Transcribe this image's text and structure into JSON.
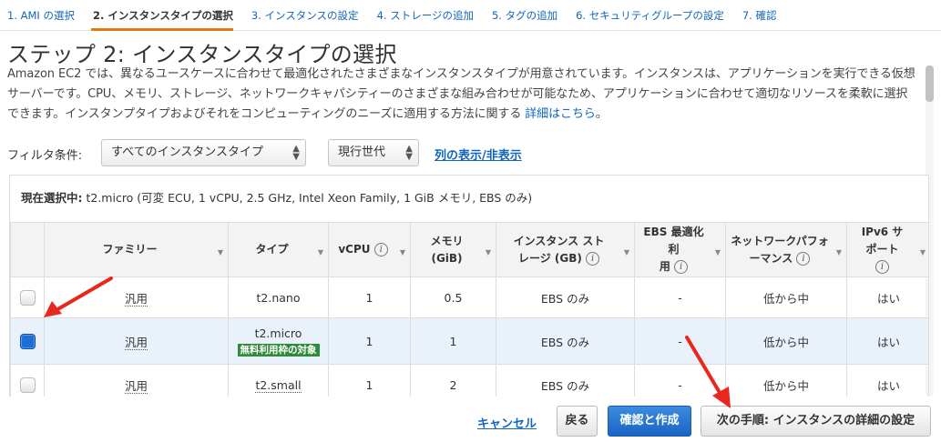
{
  "wizard": {
    "steps": [
      {
        "label": "1. AMI の選択"
      },
      {
        "label": "2. インスタンスタイプの選択"
      },
      {
        "label": "3. インスタンスの設定"
      },
      {
        "label": "4. ストレージの追加"
      },
      {
        "label": "5. タグの追加"
      },
      {
        "label": "6. セキュリティグループの設定"
      },
      {
        "label": "7. 確認"
      }
    ],
    "active_step": 1
  },
  "page": {
    "title": "ステップ 2: インスタンスタイプの選択",
    "description": "Amazon EC2 では、異なるユースケースに合わせて最適化されたさまざまなインスタンスタイプが用意されています。インスタンスは、アプリケーションを実行できる仮想サーバーです。CPU、メモリ、ストレージ、ネットワークキャパシティーのさまざまな組み合わせが可能なため、アプリケーションに合わせて適切なリソースを柔軟に選択できます。インスタンプタイプおよびそれをコンピューティングのニーズに適用する方法に関する",
    "details_link": "詳細はこちら",
    "period": "。"
  },
  "filter": {
    "label": "フィルタ条件:",
    "type_select": "すべてのインスタンスタイプ",
    "generation_select": "現行世代",
    "toggle_columns": "列の表示/非表示"
  },
  "selection": {
    "prefix": "現在選択中:",
    "value": " t2.micro (可変 ECU, 1 vCPU, 2.5 GHz, Intel Xeon Family, 1 GiB メモリ, EBS のみ)"
  },
  "table": {
    "headers": {
      "family": "ファミリー",
      "type": "タイプ",
      "vcpu": "vCPU",
      "memory_line1": "メモリ",
      "memory_line2": "(GiB)",
      "storage_line1": "インスタンス スト",
      "storage_line2": "レージ (GB)",
      "ebs_line1": "EBS 最適化利",
      "ebs_line2": "用",
      "network_line1": "ネットワークパフォ",
      "network_line2": "ーマンス",
      "ipv6_line1": "IPv6 サ",
      "ipv6_line2": "ポート"
    },
    "rows": [
      {
        "family": "汎用",
        "type": "t2.nano",
        "badge": "",
        "vcpu": "1",
        "memory": "0.5",
        "storage": "EBS のみ",
        "ebs": "-",
        "network": "低から中",
        "ipv6": "はい",
        "checked": false
      },
      {
        "family": "汎用",
        "type": "t2.micro",
        "badge": "無料利用枠の対象",
        "vcpu": "1",
        "memory": "1",
        "storage": "EBS のみ",
        "ebs": "-",
        "network": "低から中",
        "ipv6": "はい",
        "checked": true
      },
      {
        "family": "汎用",
        "type": "t2.small",
        "badge": "",
        "vcpu": "1",
        "memory": "2",
        "storage": "EBS のみ",
        "ebs": "-",
        "network": "低から中",
        "ipv6": "はい",
        "checked": false
      }
    ]
  },
  "footer": {
    "cancel": "キャンセル",
    "back": "戻る",
    "review_launch": "確認と作成",
    "next": "次の手順: インスタンスの詳細の設定"
  },
  "colors": {
    "link": "#1166bb",
    "active_tab": "#e47911",
    "primary_button": "#1a64c4",
    "free_tier_badge": "#2f8a3b",
    "annotation_arrow": "#e8281c"
  },
  "icons": {
    "info": "info-icon",
    "dropdown": "chevron-down-icon",
    "sort": "sort-icon"
  }
}
